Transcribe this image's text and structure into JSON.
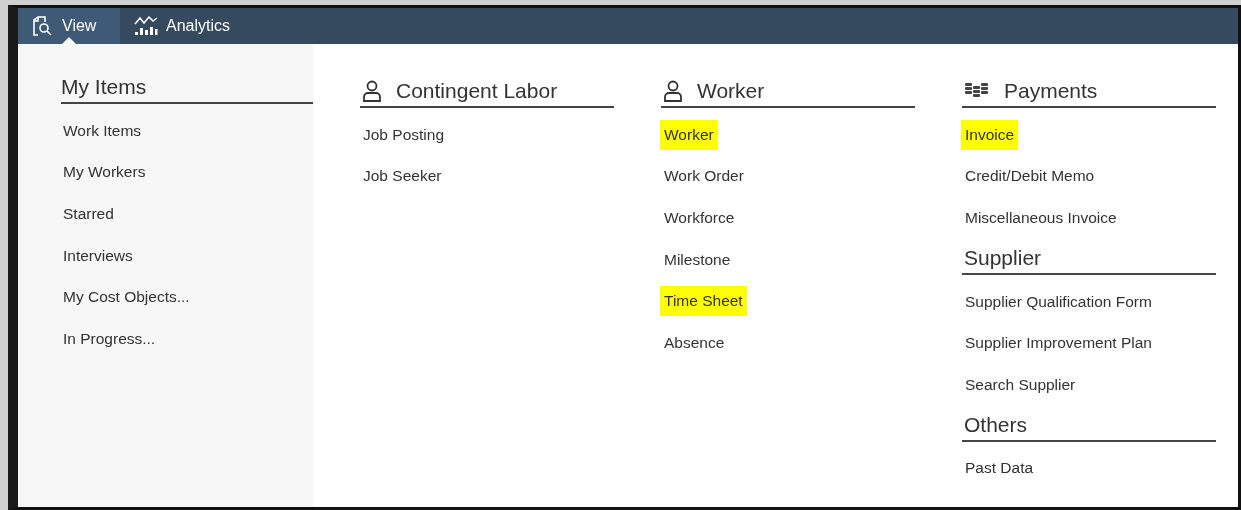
{
  "tabs": [
    {
      "label": "View",
      "kind": "view",
      "selected": true
    },
    {
      "label": "Analytics",
      "kind": "analytics",
      "selected": false
    }
  ],
  "my_items": {
    "title": "My Items",
    "items": [
      "Work Items",
      "My Workers",
      "Starred",
      "Interviews",
      "My Cost Objects...",
      "In Progress..."
    ]
  },
  "columns": [
    [
      {
        "title": "Contingent Labor",
        "kind": "person",
        "items": [
          {
            "label": "Job Posting",
            "highlighted": false
          },
          {
            "label": "Job Seeker",
            "highlighted": false
          }
        ]
      }
    ],
    [
      {
        "title": "Worker",
        "kind": "person",
        "items": [
          {
            "label": "Worker",
            "highlighted": true
          },
          {
            "label": "Work Order",
            "highlighted": false
          },
          {
            "label": "Workforce",
            "highlighted": false
          },
          {
            "label": "Milestone",
            "highlighted": false
          },
          {
            "label": "Time Sheet",
            "highlighted": true
          },
          {
            "label": "Absence",
            "highlighted": false
          }
        ]
      }
    ],
    [
      {
        "title": "Payments",
        "kind": "coins",
        "items": [
          {
            "label": "Invoice",
            "highlighted": true
          },
          {
            "label": "Credit/Debit Memo",
            "highlighted": false
          },
          {
            "label": "Miscellaneous Invoice",
            "highlighted": false
          }
        ]
      },
      {
        "title": "Supplier",
        "items": [
          {
            "label": "Supplier Qualification Form",
            "highlighted": false
          },
          {
            "label": "Supplier Improvement Plan",
            "highlighted": false
          },
          {
            "label": "Search Supplier",
            "highlighted": false
          }
        ]
      },
      {
        "title": "Others",
        "items": [
          {
            "label": "Past Data",
            "highlighted": false
          }
        ]
      }
    ]
  ]
}
